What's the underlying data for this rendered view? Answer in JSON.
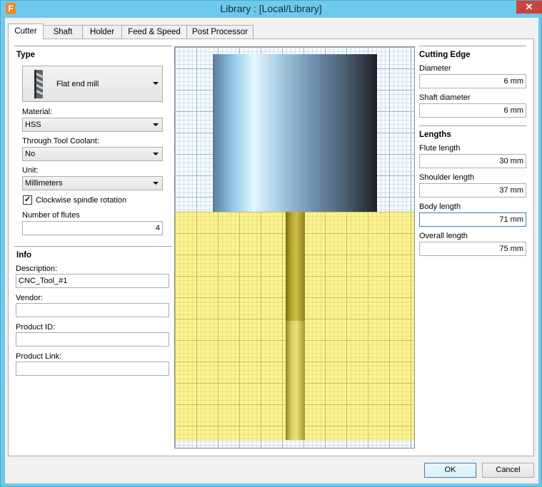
{
  "window": {
    "title": "Library :  [Local/Library]",
    "app_icon_letter": "F",
    "close_symbol": "✕"
  },
  "tabs": [
    {
      "label": "Cutter",
      "active": true
    },
    {
      "label": "Shaft",
      "active": false
    },
    {
      "label": "Holder",
      "active": false
    },
    {
      "label": "Feed & Speed",
      "active": false
    },
    {
      "label": "Post Processor",
      "active": false
    }
  ],
  "type_section": {
    "heading": "Type",
    "tool_type": "Flat end mill",
    "tool_icon": "flat-end-mill-icon",
    "material_label": "Material:",
    "material_value": "HSS",
    "coolant_label": "Through Tool Coolant:",
    "coolant_value": "No",
    "unit_label": "Unit:",
    "unit_value": "Millimeters",
    "clockwise_label": "Clockwise spindle rotation",
    "clockwise_checked": true,
    "flutes_label": "Number of flutes",
    "flutes_value": "4"
  },
  "info_section": {
    "heading": "Info",
    "description_label": "Description:",
    "description_value": "CNC_Tool_#1",
    "vendor_label": "Vendor:",
    "vendor_value": "",
    "product_id_label": "Product ID:",
    "product_id_value": "",
    "product_link_label": "Product Link:",
    "product_link_value": ""
  },
  "cutting_edge": {
    "heading": "Cutting Edge",
    "diameter_label": "Diameter",
    "diameter_value": "6 mm",
    "shaft_diameter_label": "Shaft diameter",
    "shaft_diameter_value": "6 mm"
  },
  "lengths": {
    "heading": "Lengths",
    "flute_label": "Flute length",
    "flute_value": "30 mm",
    "shoulder_label": "Shoulder length",
    "shoulder_value": "37 mm",
    "body_label": "Body length",
    "body_value": "71 mm",
    "overall_label": "Overall length",
    "overall_value": "75 mm"
  },
  "buttons": {
    "ok": "OK",
    "cancel": "Cancel"
  },
  "colors": {
    "titlebar": "#6fc8ee",
    "stock": "#fbf292",
    "close": "#c7453b"
  }
}
